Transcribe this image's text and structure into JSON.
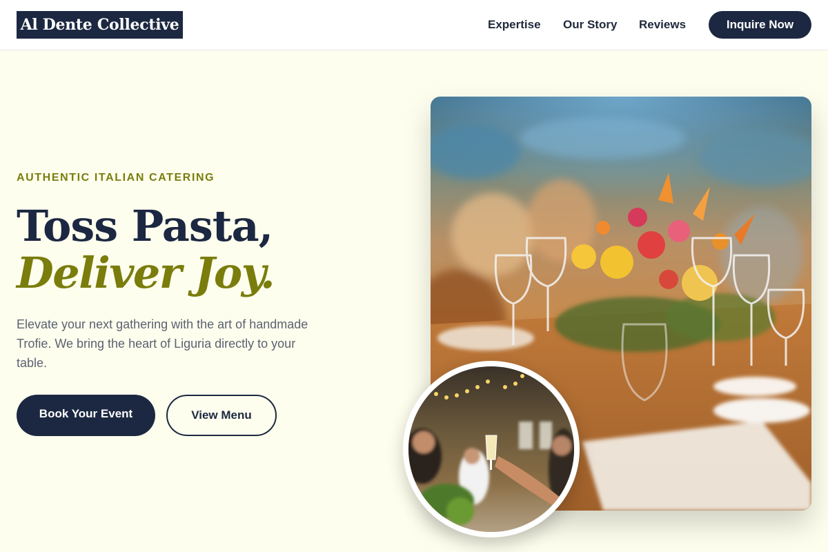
{
  "header": {
    "logo": "Al Dente Collective",
    "nav": {
      "expertise": "Expertise",
      "story": "Our Story",
      "reviews": "Reviews"
    },
    "cta": "Inquire Now"
  },
  "hero": {
    "eyebrow": "AUTHENTIC ITALIAN CATERING",
    "headline_line1": "Toss Pasta,",
    "headline_line2": "Deliver Joy.",
    "lede": "Elevate your next gathering with the art of handmade Trofie. We bring the heart of Liguria directly to your table.",
    "primary_button": "Book Your Event",
    "secondary_button": "View Menu"
  },
  "colors": {
    "navy": "#1c2841",
    "olive": "#7a7d0c",
    "background": "#fefeee",
    "body_text": "#5b6170"
  }
}
